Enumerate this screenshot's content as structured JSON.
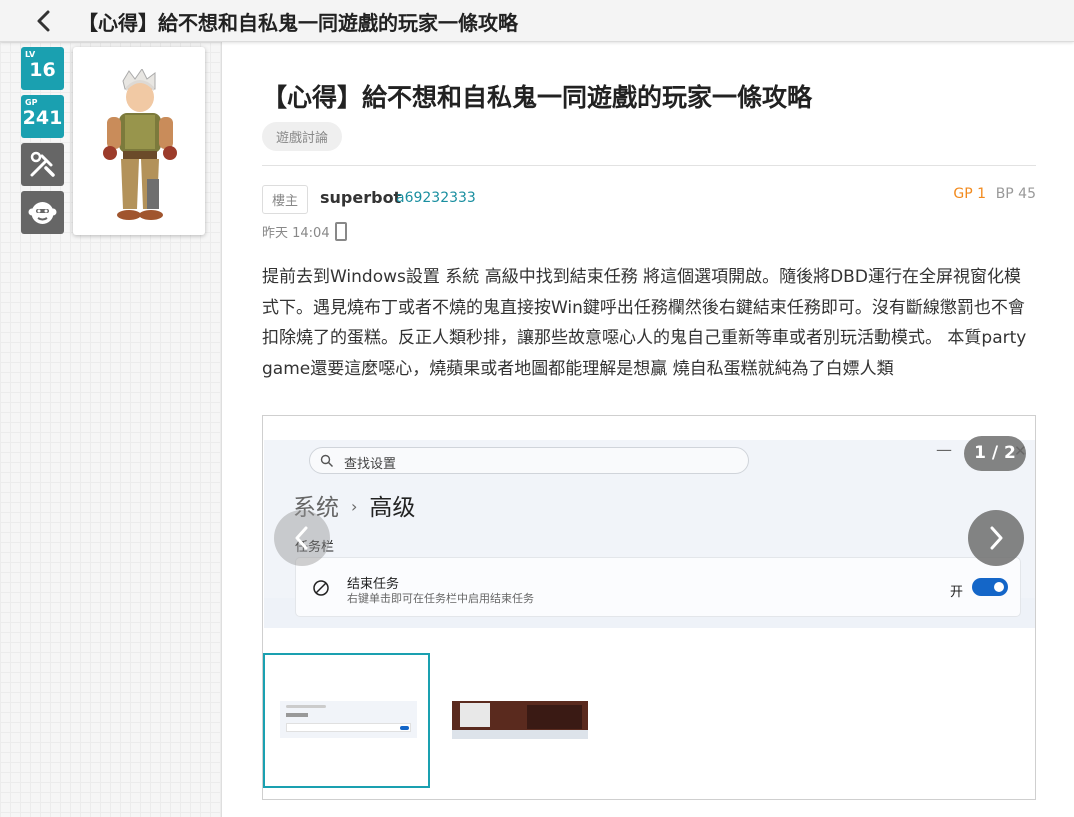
{
  "topbar": {
    "title": "【心得】給不想和自私鬼一同遊戲的玩家一條攻略"
  },
  "sidebar": {
    "level": {
      "label": "LV",
      "value": "16"
    },
    "gp": {
      "label": "GP",
      "value": "241"
    },
    "tools_icon": "tools-icon",
    "monkey_icon": "monkey-icon"
  },
  "post": {
    "title": "【心得】給不想和自私鬼一同遊戲的玩家一條攻略",
    "tag": "遊戲討論",
    "floor": "樓主",
    "username": "superbot",
    "user_id": "a69232333",
    "gp": "GP 1",
    "bp": "BP 45",
    "time": "昨天 14:04",
    "body": "提前去到Windows設置 系統 高級中找到結束任務 將這個選項開啟。隨後將DBD運行在全屏視窗化模式下。遇見燒布丁或者不燒的鬼直接按Win鍵呼出任務欄然後右鍵結束任務即可。沒有斷線懲罰也不會扣除燒了的蛋糕。反正人類秒排，讓那些故意噁心人的鬼自己重新等車或者別玩活動模式。 本質party game還要這麼噁心，燒蘋果或者地圖都能理解是想贏 燒自私蛋糕就純為了白嫖人類"
  },
  "gallery": {
    "counter": "1 / 2",
    "screenshot": {
      "search_placeholder": "查找设置",
      "min_symbol": "—",
      "close_symbol": "✕",
      "crumb_parent": "系统",
      "crumb_sep": "›",
      "crumb_current": "高级",
      "section": "任务栏",
      "setting_title": "结束任务",
      "setting_desc": "右键单击即可在任务栏中启用结束任务",
      "setting_state": "开"
    }
  },
  "colors": {
    "accent": "#1aa0b0",
    "gp_orange": "#f28a1d",
    "toggle_blue": "#1466c8"
  }
}
